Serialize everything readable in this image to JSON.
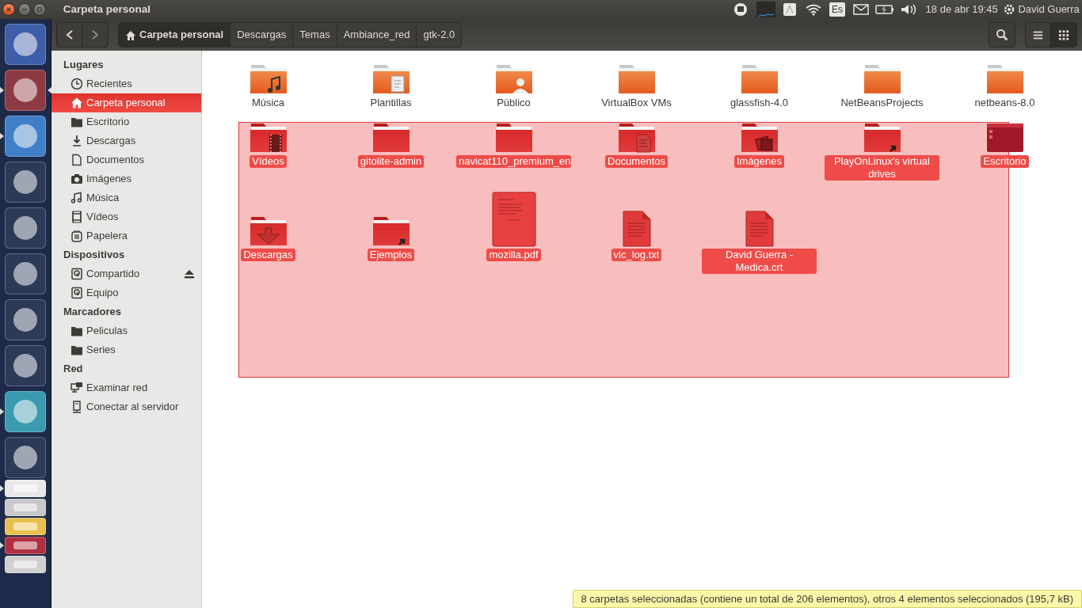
{
  "window": {
    "title": "Carpeta personal"
  },
  "top_bar": {
    "indicators": [
      {
        "kind": "network"
      },
      {
        "kind": "monitor"
      },
      {
        "kind": "notes"
      },
      {
        "kind": "wifi"
      },
      {
        "kind": "keyboard",
        "label": "Es"
      },
      {
        "kind": "mail"
      },
      {
        "kind": "battery"
      },
      {
        "kind": "volume"
      }
    ],
    "clock": "18 de abr 19:45",
    "user": "David Guerra"
  },
  "launcher": [
    {
      "color": "#3d5ea8",
      "running": false,
      "focused": false,
      "stacked": false
    },
    {
      "color": "#8e3a42",
      "running": true,
      "focused": true,
      "stacked": false
    },
    {
      "color": "#3f7fc8",
      "running": true,
      "focused": false,
      "stacked": false
    },
    {
      "color": "#2c3a58",
      "running": false,
      "focused": false,
      "stacked": false
    },
    {
      "color": "#2c3a58",
      "running": false,
      "focused": false,
      "stacked": false
    },
    {
      "color": "#2c3a58",
      "running": false,
      "focused": false,
      "stacked": false
    },
    {
      "color": "#2c3a58",
      "running": false,
      "focused": false,
      "stacked": false
    },
    {
      "color": "#2c3a58",
      "running": false,
      "focused": false,
      "stacked": false
    },
    {
      "color": "#3a9ab0",
      "running": true,
      "focused": false,
      "stacked": false
    },
    {
      "color": "#2c3a58",
      "running": false,
      "focused": false,
      "stacked": false
    },
    {
      "color": "#e8e8e8",
      "running": true,
      "focused": false,
      "stacked": true
    },
    {
      "color": "#c8c8c8",
      "running": false,
      "focused": false,
      "stacked": true
    },
    {
      "color": "#e8c050",
      "running": false,
      "focused": false,
      "stacked": true
    },
    {
      "color": "#b03040",
      "running": true,
      "focused": false,
      "stacked": true
    },
    {
      "color": "#d0d0d0",
      "running": false,
      "focused": false,
      "stacked": true
    }
  ],
  "toolbar": {
    "path": [
      {
        "label": "Carpeta personal",
        "home": true,
        "selected": true
      },
      {
        "label": "Descargas",
        "home": false,
        "selected": false
      },
      {
        "label": "Temas",
        "home": false,
        "selected": false
      },
      {
        "label": "Ambiance_red",
        "home": false,
        "selected": false
      },
      {
        "label": "gtk-2.0",
        "home": false,
        "selected": false
      }
    ],
    "views": [
      {
        "kind": "list",
        "selected": false
      },
      {
        "kind": "grid",
        "selected": true
      }
    ]
  },
  "sidebar": [
    {
      "heading": "Lugares",
      "items": [
        {
          "label": "Recientes",
          "kind": "recent",
          "selected": false,
          "eject": false
        },
        {
          "label": "Carpeta personal",
          "kind": "home",
          "selected": true,
          "eject": false
        },
        {
          "label": "Escritorio",
          "kind": "folder",
          "selected": false,
          "eject": false
        },
        {
          "label": "Descargas",
          "kind": "downloads",
          "selected": false,
          "eject": false
        },
        {
          "label": "Documentos",
          "kind": "documents",
          "selected": false,
          "eject": false
        },
        {
          "label": "Imágenes",
          "kind": "pictures",
          "selected": false,
          "eject": false
        },
        {
          "label": "Música",
          "kind": "music",
          "selected": false,
          "eject": false
        },
        {
          "label": "Vídeos",
          "kind": "videos",
          "selected": false,
          "eject": false
        },
        {
          "label": "Papelera",
          "kind": "trash",
          "selected": false,
          "eject": false
        }
      ]
    },
    {
      "heading": "Dispositivos",
      "items": [
        {
          "label": "Compartido",
          "kind": "drive",
          "selected": false,
          "eject": true
        },
        {
          "label": "Equipo",
          "kind": "drive",
          "selected": false,
          "eject": false
        }
      ]
    },
    {
      "heading": "Marcadores",
      "items": [
        {
          "label": "Peliculas",
          "kind": "folder",
          "selected": false,
          "eject": false
        },
        {
          "label": "Series",
          "kind": "folder",
          "selected": false,
          "eject": false
        }
      ]
    },
    {
      "heading": "Red",
      "items": [
        {
          "label": "Examinar red",
          "kind": "network",
          "selected": false,
          "eject": false
        },
        {
          "label": "Conectar al servidor",
          "kind": "server",
          "selected": false,
          "eject": false
        }
      ]
    }
  ],
  "files": [
    {
      "name": "Música",
      "kind": "music",
      "selected": false
    },
    {
      "name": "Plantillas",
      "kind": "templates",
      "selected": false
    },
    {
      "name": "Público",
      "kind": "public",
      "selected": false
    },
    {
      "name": "VirtualBox VMs",
      "kind": "folder",
      "selected": false
    },
    {
      "name": "glassfish-4.0",
      "kind": "folder",
      "selected": false
    },
    {
      "name": "NetBeansProjects",
      "kind": "folder",
      "selected": false
    },
    {
      "name": "netbeans-8.0",
      "kind": "folder",
      "selected": false
    },
    {
      "name": "Vídeos",
      "kind": "videos",
      "selected": true
    },
    {
      "name": "gitolite-admin",
      "kind": "folder",
      "selected": true
    },
    {
      "name": "navicat110_premium_en",
      "kind": "folder",
      "selected": true
    },
    {
      "name": "Documentos",
      "kind": "documents",
      "selected": true
    },
    {
      "name": "Imágenes",
      "kind": "pictures",
      "selected": true
    },
    {
      "name": "PlayOnLinux's virtual drives",
      "kind": "link",
      "selected": true
    },
    {
      "name": "Escritorio",
      "kind": "desktop",
      "selected": true
    },
    {
      "name": "Descargas",
      "kind": "downloads",
      "selected": true
    },
    {
      "name": "Ejemplos",
      "kind": "link",
      "selected": true
    },
    {
      "name": "mozilla.pdf",
      "kind": "pdf",
      "selected": true
    },
    {
      "name": "vlc_log.txt",
      "kind": "text",
      "selected": true
    },
    {
      "name": "David Guerra - Medica.crt",
      "kind": "text",
      "selected": true
    }
  ],
  "rubber_band": true,
  "status_bar": "8 carpetas seleccionadas (contiene un total de 206 elementos), otros 4 elementos seleccionados (195,7 kB)"
}
